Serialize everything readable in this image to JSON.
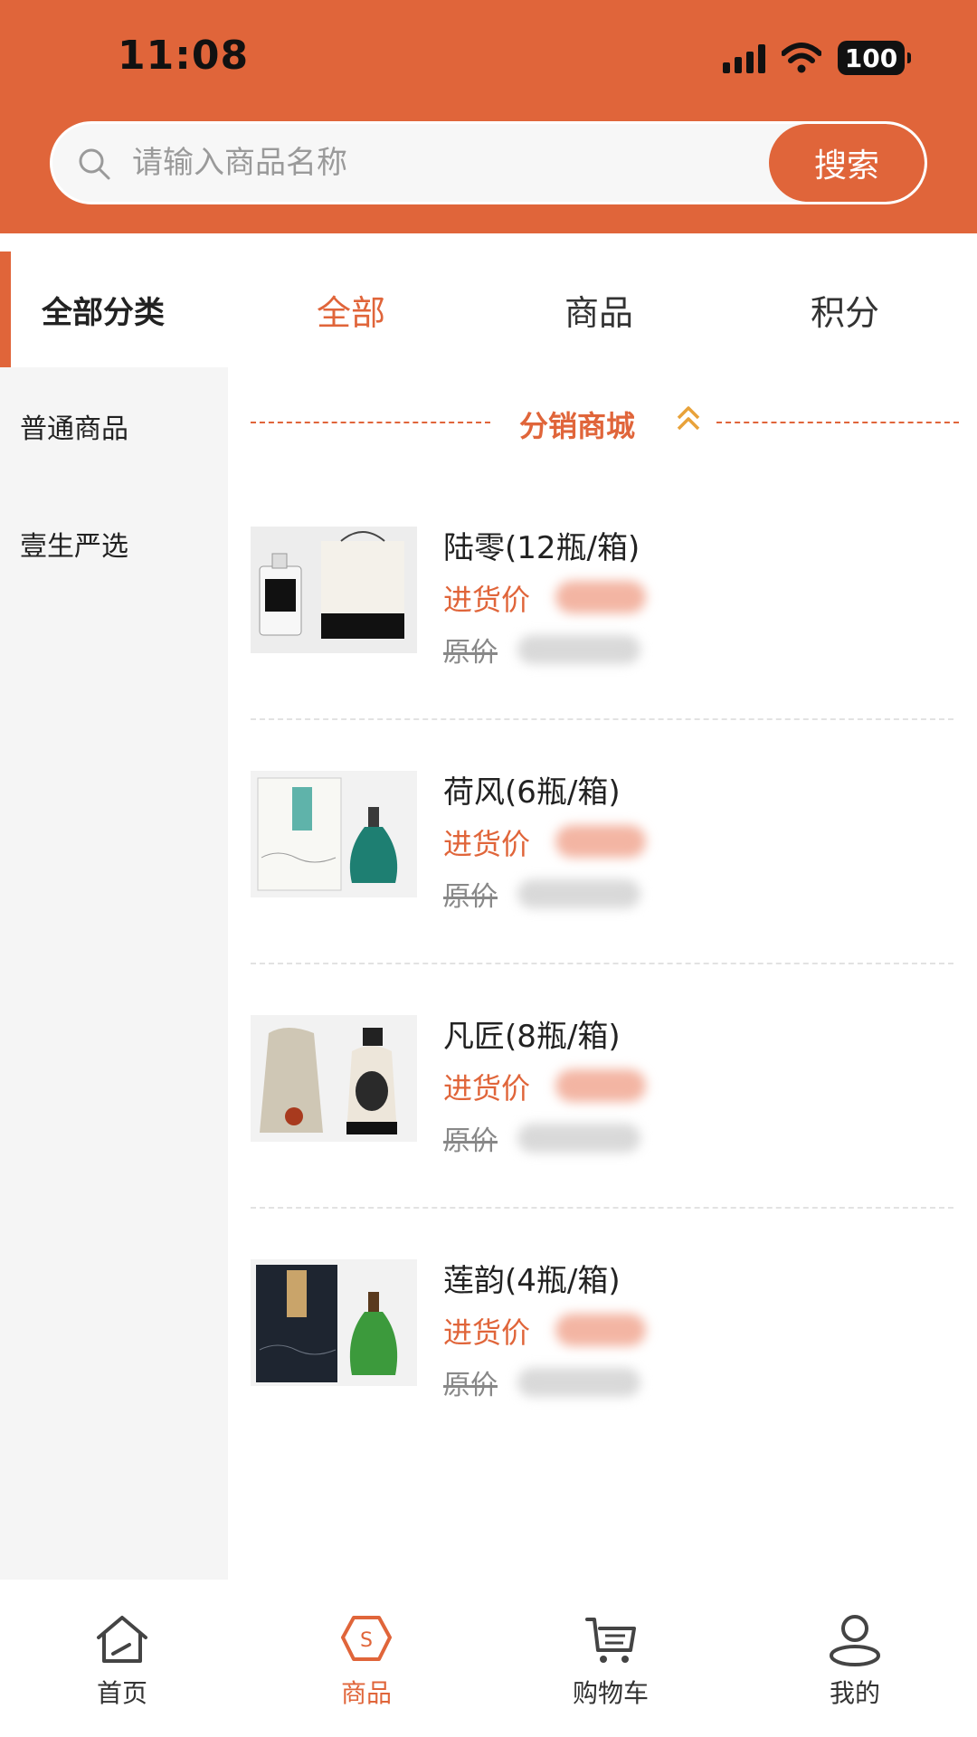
{
  "status_bar": {
    "time": "11:08",
    "battery": "100",
    "icons": [
      "cellular-signal-icon",
      "wifi-icon",
      "battery-icon"
    ]
  },
  "search": {
    "placeholder": "请输入商品名称",
    "button_label": "搜索"
  },
  "filter_tabs": {
    "all_categories": "全部分类",
    "tabs": [
      {
        "label": "全部",
        "active": true
      },
      {
        "label": "商品",
        "active": false
      },
      {
        "label": "积分",
        "active": false
      }
    ]
  },
  "sidebar": {
    "items": [
      {
        "label": "普通商品"
      },
      {
        "label": "壹生严选"
      }
    ]
  },
  "section": {
    "title": "分销商城",
    "icon": "double-chevron-up-icon"
  },
  "products": [
    {
      "name": "陆零(12瓶/箱)",
      "price_label": "进货价",
      "original_label": "原价"
    },
    {
      "name": "荷风(6瓶/箱)",
      "price_label": "进货价",
      "original_label": "原价"
    },
    {
      "name": "凡匠(8瓶/箱)",
      "price_label": "进货价",
      "original_label": "原价"
    },
    {
      "name": "莲韵(4瓶/箱)",
      "price_label": "进货价",
      "original_label": "原价"
    }
  ],
  "bottom_nav": {
    "items": [
      {
        "label": "首页",
        "icon": "home-icon",
        "active": false
      },
      {
        "label": "商品",
        "icon": "shop-icon",
        "active": true
      },
      {
        "label": "购物车",
        "icon": "cart-icon",
        "active": false
      },
      {
        "label": "我的",
        "icon": "user-icon",
        "active": false
      }
    ]
  },
  "colors": {
    "brand": "#E0653A",
    "sidebar_bg": "#F5F5F5"
  }
}
